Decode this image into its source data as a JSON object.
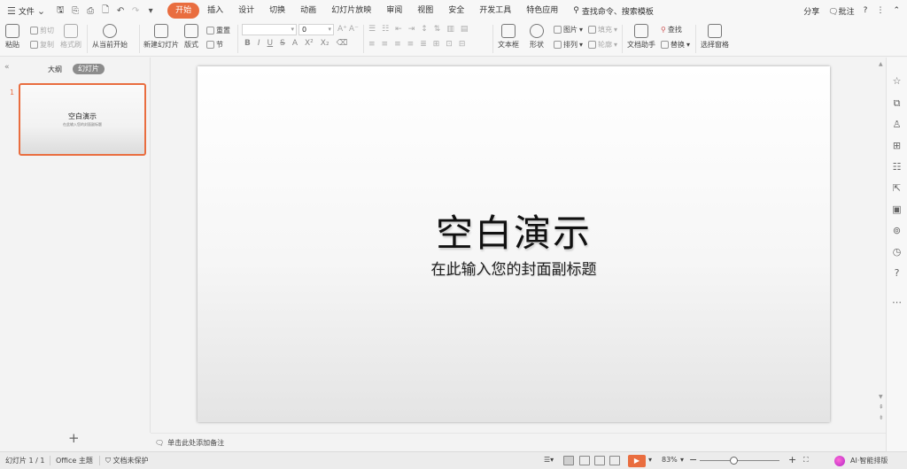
{
  "app": {
    "file_menu": "文件",
    "tabs": [
      "开始",
      "插入",
      "设计",
      "切换",
      "动画",
      "幻灯片放映",
      "审阅",
      "视图",
      "安全",
      "开发工具",
      "特色应用"
    ],
    "active_tab": 0,
    "search_command": "查找命令、搜索模板",
    "share": "分享",
    "comment": "批注",
    "accent_color": "#e96d3f"
  },
  "ribbon": {
    "paste": "粘贴",
    "cut": "剪切",
    "copy": "复制",
    "format_painter": "格式刷",
    "from_current": "从当前开始",
    "new_slide": "新建幻灯片",
    "layout": "版式",
    "section": "节",
    "reset": "重置",
    "font_size": "0",
    "format_buttons": [
      "B",
      "I",
      "U",
      "S",
      "A",
      "X²",
      "X₂",
      "A"
    ],
    "textbox": "文本框",
    "shape": "形状",
    "picture": "图片",
    "fill": "填充",
    "arrange": "排列",
    "outline": "轮廓",
    "doc_assistant": "文档助手",
    "find": "查找",
    "replace": "替换",
    "selection_pane": "选择窗格"
  },
  "left_panel": {
    "outline_tab": "大纲",
    "slides_tab": "幻灯片",
    "slide_number": "1",
    "thumb_title": "空白演示",
    "thumb_subtitle": "在此输入您的封面副标题",
    "add_slide": "+"
  },
  "slide": {
    "title": "空白演示",
    "subtitle": "在此输入您的封面副标题"
  },
  "notes": {
    "placeholder": "单击此处添加备注"
  },
  "status": {
    "slide_count": "幻灯片 1 / 1",
    "theme": "Office 主题",
    "protection": "文档未保护",
    "zoom": "83%",
    "ai_layout": "AI·智能排版"
  }
}
